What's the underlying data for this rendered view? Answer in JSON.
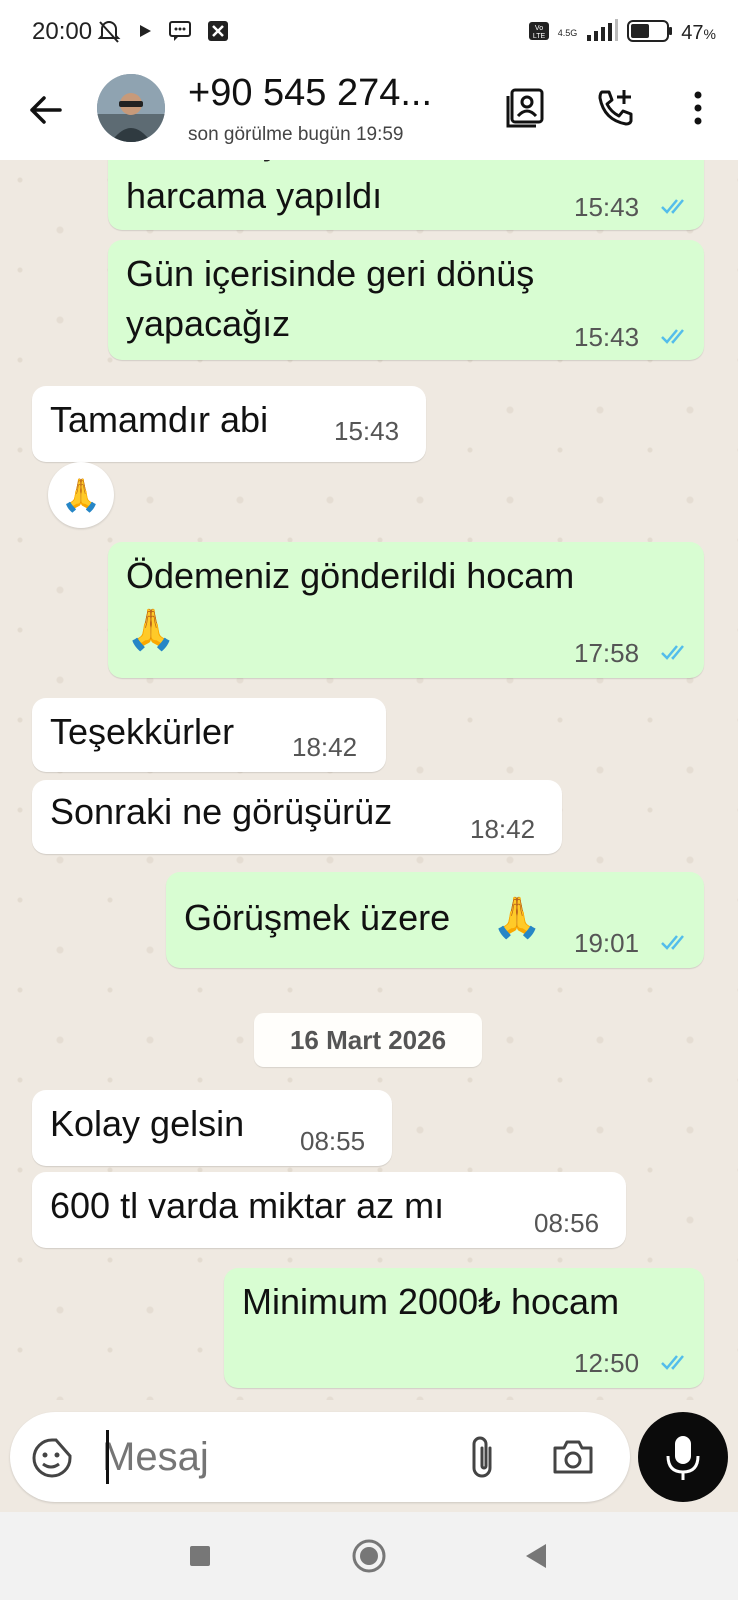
{
  "status_bar": {
    "time": "20:00",
    "network_top": "4.5G",
    "volte": "Vo LTE",
    "battery_pct": "47",
    "battery_unit": "%"
  },
  "header": {
    "title": "+90 545 274...",
    "subtitle": "son görülme bugün 19:59",
    "icons": [
      "back-arrow-icon",
      "contact-card-icon",
      "add-call-icon",
      "more-vert-icon"
    ]
  },
  "messages": [
    {
      "dir": "out",
      "text_top_partial": "Hesabı işlem tamam",
      "text": "harcama yapıldı",
      "time": "15:43"
    },
    {
      "dir": "out",
      "text_line1": "Gün içerisinde geri dönüş",
      "text_line2": "yapacağız",
      "time": "15:43"
    },
    {
      "dir": "in",
      "text": "Tamamdır abi",
      "time": "15:43",
      "reaction": "🙏"
    },
    {
      "dir": "out",
      "text": "Ödemeniz gönderildi hocam",
      "emoji": "🙏",
      "time": "17:58"
    },
    {
      "dir": "in",
      "text": "Teşekkürler",
      "time": "18:42"
    },
    {
      "dir": "in",
      "text": "Sonraki ne görüşürüz",
      "time": "18:42"
    },
    {
      "dir": "out",
      "text": "Görüşmek üzere",
      "emoji": "🙏",
      "time": "19:01"
    },
    {
      "dir": "in",
      "text": "Kolay gelsin",
      "time": "08:55"
    },
    {
      "dir": "in",
      "text": "600 tl varda miktar az mı",
      "time": "08:56"
    },
    {
      "dir": "out",
      "text": "Minimum 2000₺ hocam",
      "time": "12:50"
    }
  ],
  "date_divider": "16 Mart 2026",
  "composer": {
    "placeholder": "Mesaj"
  },
  "colors": {
    "outgoing_bubble": "#d8fdd2",
    "incoming_bubble": "#ffffff",
    "read_ticks": "#53bdeb",
    "chat_background": "#efe9e1"
  }
}
